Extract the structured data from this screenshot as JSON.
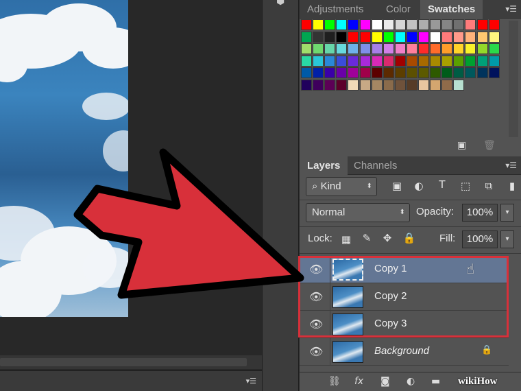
{
  "swatches_panel": {
    "tabs": [
      {
        "label": "Adjustments",
        "active": false
      },
      {
        "label": "Color",
        "active": false
      },
      {
        "label": "Swatches",
        "active": true
      }
    ],
    "rows": [
      [
        "#ff0000",
        "#ffff00",
        "#00ff00",
        "#00ffff",
        "#0000ff",
        "#ff00ff",
        "#ffffff",
        "#ebebeb",
        "#d6d6d6",
        "#c2c2c2",
        "#adadad",
        "#999999",
        "#858585",
        "#707070",
        "#ff7b7b",
        "#ff0000",
        "#ff0000"
      ],
      [
        "#00a651",
        "#333333",
        "#1f1f1f",
        "#000000",
        "#ff0000",
        "#ff0000",
        "#ffff00",
        "#00ff00",
        "#00ffff",
        "#0000ff",
        "#ff00ff",
        "#ffffff",
        "#ff7b7b",
        "#ff9a8a",
        "#ffb37a",
        "#ffc870",
        "#fff67f"
      ],
      [
        "#a0dd6b",
        "#6fd86f",
        "#66d6a9",
        "#67d9dd",
        "#6fb2ea",
        "#7f8fe8",
        "#a77fe6",
        "#d07fe6",
        "#f07fc8",
        "#ff7f9c",
        "#ff2a2a",
        "#ff6c2a",
        "#ff9d2a",
        "#ffd42a",
        "#f9f22a",
        "#93d92a",
        "#2ad94a"
      ],
      [
        "#2ad8a4",
        "#2ac6d9",
        "#2a88d9",
        "#3a4dd9",
        "#6a2ad9",
        "#a82ad9",
        "#d92ab6",
        "#d92a6d",
        "#a00000",
        "#a84a00",
        "#a86a00",
        "#a88a00",
        "#a8a000",
        "#5aa000",
        "#00a030",
        "#00a078",
        "#009aa8"
      ],
      [
        "#005aa8",
        "#0020a8",
        "#3a00a8",
        "#6a00a8",
        "#a0009a",
        "#a0004a",
        "#5c0000",
        "#5c2a00",
        "#5c3e00",
        "#5c5000",
        "#5c5a00",
        "#2e5a00",
        "#005c1a",
        "#005c44",
        "#00585c",
        "#00335c",
        "#00125c"
      ],
      [
        "#20005c",
        "#3e005c",
        "#5c0056",
        "#5c002a",
        "#efd9b8",
        "#c7a985",
        "#a58763",
        "#8a6b4b",
        "#6f523b",
        "#563c27",
        "#e8c6a0",
        "#d4a66f",
        "#8f6b4a",
        "#b7e0d0"
      ]
    ],
    "new_swatch_icon": "new-swatch-icon",
    "delete_icon": "trash-icon"
  },
  "layers_panel": {
    "tabs": [
      {
        "label": "Layers",
        "active": true
      },
      {
        "label": "Channels",
        "active": false
      }
    ],
    "filter_kind": "Kind",
    "blend_mode": "Normal",
    "opacity_label": "Opacity:",
    "opacity_value": "100%",
    "lock_label": "Lock:",
    "fill_label": "Fill:",
    "fill_value": "100%",
    "layers": [
      {
        "name": "Copy 1",
        "selected": true,
        "visible": true,
        "locked": false
      },
      {
        "name": "Copy 2",
        "selected": false,
        "visible": true,
        "locked": false
      },
      {
        "name": "Copy 3",
        "selected": false,
        "visible": true,
        "locked": false
      },
      {
        "name": "Background",
        "selected": false,
        "visible": true,
        "locked": true
      }
    ]
  },
  "watermark": "wikiHow",
  "colors": {
    "annotation_arrow": "#d8303a",
    "selected_layer": "#637694",
    "panel_bg": "#535353"
  }
}
